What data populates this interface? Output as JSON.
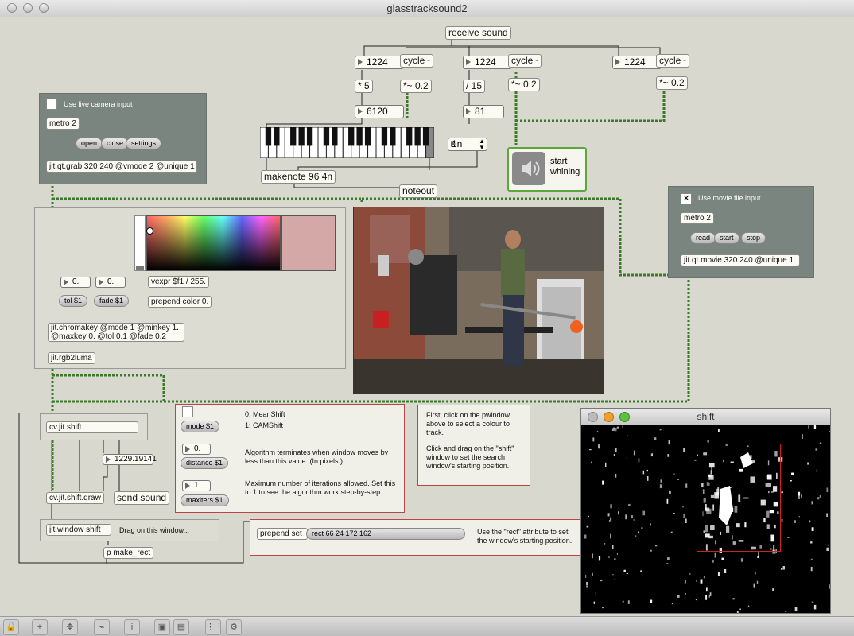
{
  "window": {
    "title": "glasstracksound2"
  },
  "top": {
    "receive": "receive sound",
    "num1": "1224",
    "mul1": "* 5",
    "out1": "6120",
    "cycle1": "cycle~",
    "gain1": "*~ 0.2",
    "num2": "1224",
    "div2": "/ 15",
    "out2": "81",
    "cycle2": "cycle~",
    "gain2": "*~ 0.2",
    "num3": "1224",
    "cycle3": "cycle~",
    "gain3": "*~ 0.2",
    "makenote": "makenote 96 4n",
    "noteout": "noteout",
    "umenu": "1n",
    "ezdac_label": "start\nwhining"
  },
  "camera": {
    "toggle_label": "Use live camera input",
    "metro": "metro 2",
    "open": "open",
    "close": "close",
    "settings": "settings",
    "grab": "jit.qt.grab 320 240 @vmode 2 @unique 1"
  },
  "movie": {
    "toggle_label": "Use movie file input",
    "metro": "metro 2",
    "read": "read",
    "start": "start",
    "stop": "stop",
    "movie": "jit.qt.movie 320 240 @unique 1"
  },
  "chroma": {
    "vexpr": "vexpr $f1 / 255.",
    "prepend": "prepend color 0.",
    "tol_num": "0.",
    "fade_num": "0.",
    "tol_msg": "tol $1",
    "fade_msg": "fade $1",
    "chromakey": "jit.chromakey @mode 1 @minkey 1. @maxkey 0. @tol 0.1 @fade 0.2",
    "rgb2luma": "jit.rgb2luma",
    "swatch_color": "#d4a8a6"
  },
  "shift": {
    "cvshift": "cv.jit.shift",
    "num": "1229.19141",
    "send": "send sound",
    "draw": "cv.jit.shift.draw",
    "window": "jit.window shift",
    "drag_hint": "Drag on this window...",
    "make_rect": "p make_rect"
  },
  "params": {
    "mode_msg": "mode $1",
    "mode0": "0: MeanShift",
    "mode1": "1: CAMShift",
    "dist_num": "0.",
    "dist_msg": "distance $1",
    "dist_text": "Algorithm terminates when window moves by less than this value. (In pixels.)",
    "iter_num": "1",
    "iter_msg": "maxiters $1",
    "iter_text": "Maximum number of iterations allowed. Set this to 1 to see the algorithm work step-by-step."
  },
  "instructions": {
    "p1": "First, click on the pwindow above to select a colour to track.",
    "p2": "Click and drag on the \"shift\" window to set the search window's starting position."
  },
  "rect": {
    "prepend": "prepend set",
    "msg": "rect 66 24 172 162",
    "note": "Use the \"rect\" attribute to set the window's starting position."
  },
  "shiftwin": {
    "title": "shift"
  },
  "toolbar": [
    "lock-icon",
    "add-icon",
    "move-icon",
    "patcher-icon",
    "info-icon",
    "windows-icon",
    "windows2-icon",
    "grid-icon",
    "gear-icon"
  ]
}
